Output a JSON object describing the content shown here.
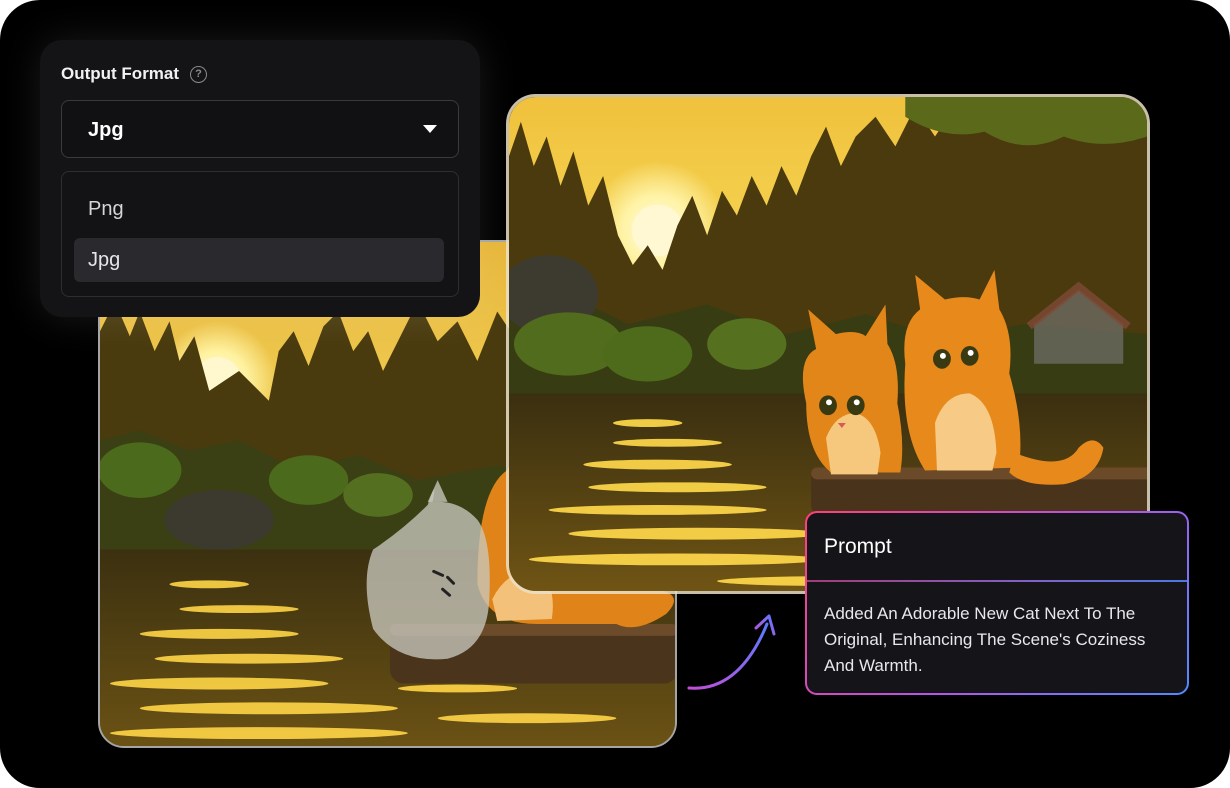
{
  "format": {
    "title": "Output Format",
    "help_icon": "question-circle-icon",
    "selected": "Jpg",
    "options": [
      {
        "label": "Png",
        "selected": false
      },
      {
        "label": "Jpg",
        "selected": true
      }
    ]
  },
  "prompt": {
    "title": "Prompt",
    "text": "Added An Adorable New Cat Next To The Original, Enhancing The Scene's Coziness And Warmth."
  },
  "colors": {
    "background": "#000000",
    "card": "#141416",
    "gradient_start": "#ff3f7a",
    "gradient_end": "#4f8bff"
  }
}
